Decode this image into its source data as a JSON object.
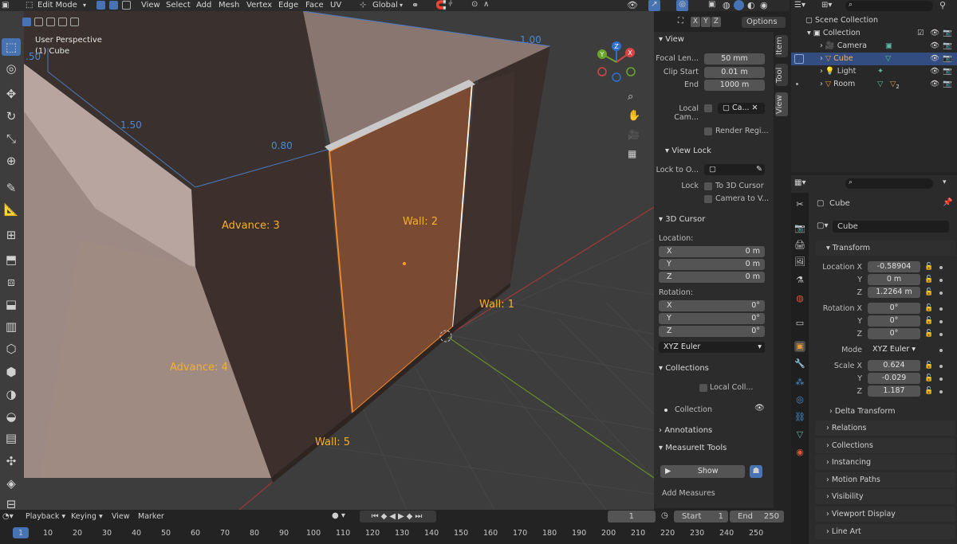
{
  "header": {
    "mode": "Edit Mode",
    "menus": [
      "View",
      "Select",
      "Add",
      "Mesh",
      "Vertex",
      "Edge",
      "Face",
      "UV"
    ],
    "orientation": "Global",
    "options": "Options",
    "axes": [
      "X",
      "Y",
      "Z"
    ]
  },
  "viewport": {
    "perspective": "User Perspective",
    "object": "(1) Cube",
    "labels": {
      "advance3": "Advance: 3",
      "advance4": "Advance: 4",
      "wall2": "Wall: 2",
      "wall1": "Wall: 1",
      "wall5": "Wall: 5"
    },
    "dims": {
      "d150a": ".50",
      "d150": "1.50",
      "d080": "0.80",
      "d100": "1.00"
    },
    "gizmo": {
      "x": "X",
      "y": "Y",
      "z": "Z"
    }
  },
  "npanel": {
    "view_header": "View",
    "focal_label": "Focal Len...",
    "focal_value": "50 mm",
    "clip_start_label": "Clip Start",
    "clip_start_value": "0.01 m",
    "end_label": "End",
    "end_value": "1000 m",
    "local_cam_label": "Local Cam...",
    "local_cam_value": "Ca...",
    "render_region": "Render Regi...",
    "view_lock_header": "View Lock",
    "lock_to_label": "Lock to O...",
    "lock_label": "Lock",
    "to_3d_cursor": "To 3D Cursor",
    "camera_to_view": "Camera to V...",
    "cursor_header": "3D Cursor",
    "location_label": "Location:",
    "cx_label": "X",
    "cx_value": "0 m",
    "cy_label": "Y",
    "cy_value": "0 m",
    "cz_label": "Z",
    "cz_value": "0 m",
    "rotation_label": "Rotation:",
    "rx_label": "X",
    "rx_value": "0°",
    "ry_label": "Y",
    "ry_value": "0°",
    "rz_label": "Z",
    "rz_value": "0°",
    "rot_mode": "XYZ Euler",
    "collections_header": "Collections",
    "local_coll": "Local Coll...",
    "collection_item": "Collection",
    "annotations_header": "Annotations",
    "measureit_header": "MeasureIt Tools",
    "show_button": "Show",
    "add_measures": "Add Measures",
    "tabs": [
      "Item",
      "Tool",
      "View"
    ]
  },
  "outliner": {
    "scene_collection": "Scene Collection",
    "rows": [
      {
        "name": "Collection"
      },
      {
        "name": "Camera"
      },
      {
        "name": "Cube"
      },
      {
        "name": "Light"
      },
      {
        "name": "Room"
      }
    ],
    "room_badge": "2"
  },
  "properties": {
    "object_name": "Cube",
    "mesh_name": "Cube",
    "transform_header": "Transform",
    "loc_x_label": "Location X",
    "loc_x": "-0.58904",
    "loc_y_label": "Y",
    "loc_y": "0 m",
    "loc_z_label": "Z",
    "loc_z": "1.2264 m",
    "rot_x_label": "Rotation X",
    "rot_x": "0°",
    "rot_y_label": "Y",
    "rot_y": "0°",
    "rot_z_label": "Z",
    "rot_z": "0°",
    "mode_label": "Mode",
    "mode_value": "XYZ Euler",
    "scale_x_label": "Scale X",
    "scale_x": "0.624",
    "scale_y_label": "Y",
    "scale_y": "-0.029",
    "scale_z_label": "Z",
    "scale_z": "1.187",
    "delta_header": "Delta Transform",
    "sections": [
      "Relations",
      "Collections",
      "Instancing",
      "Motion Paths",
      "Visibility",
      "Viewport Display",
      "Line Art"
    ]
  },
  "timeline": {
    "playback": "Playback",
    "keying": "Keying",
    "view": "View",
    "marker": "Marker",
    "current_frame": "1",
    "start_label": "Start",
    "start_value": "1",
    "end_label": "End",
    "end_value": "250",
    "ticks": [
      "1",
      "10",
      "20",
      "30",
      "40",
      "50",
      "60",
      "70",
      "80",
      "90",
      "100",
      "110",
      "120",
      "130",
      "140",
      "150",
      "160",
      "170",
      "180",
      "190",
      "200",
      "210",
      "220",
      "230",
      "240",
      "250"
    ]
  },
  "colors": {
    "accent": "#4772b3",
    "label": "#f5b12a",
    "dimension": "#4b8ad3",
    "selected_face": "#e58c2e"
  }
}
